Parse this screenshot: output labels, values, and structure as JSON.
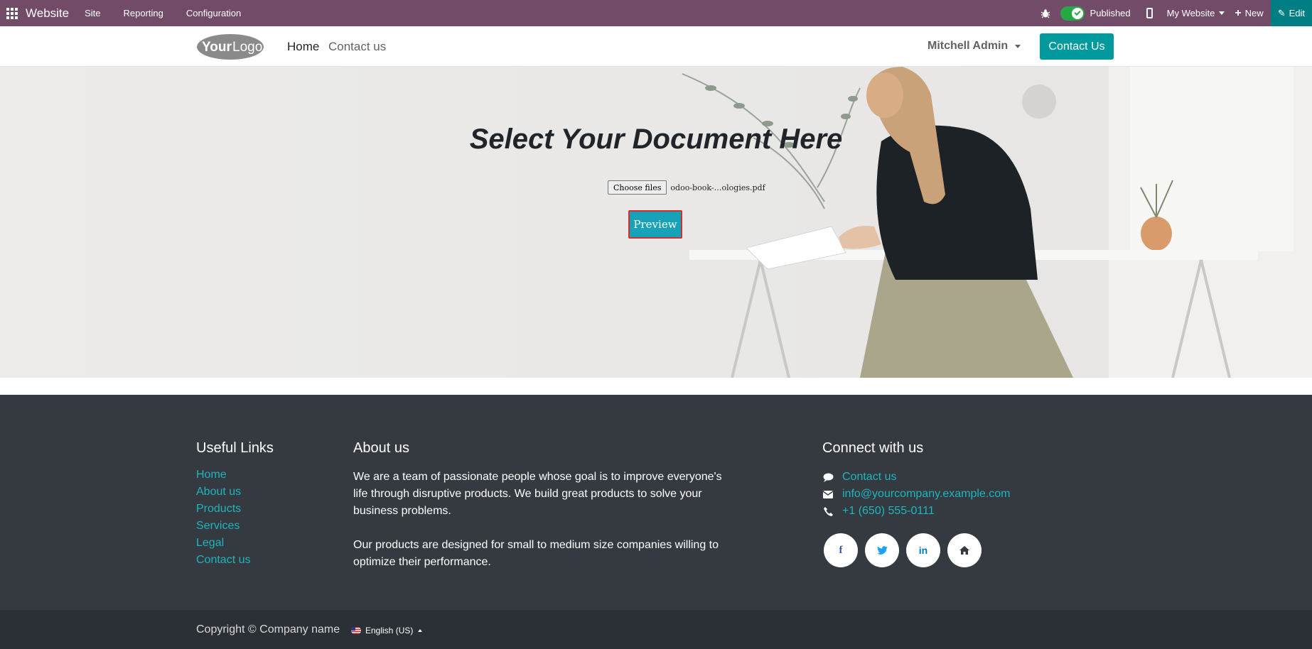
{
  "adminbar": {
    "brand": "Website",
    "menu": [
      "Site",
      "Reporting",
      "Configuration"
    ],
    "published_label": "Published",
    "website_selector": "My Website",
    "new_label": "New",
    "edit_label": "Edit",
    "colors": {
      "bar": "#714B67",
      "edit": "#017e84",
      "toggle_on": "#28a745"
    }
  },
  "header": {
    "logo_text": "YourLogo",
    "nav": [
      "Home",
      "Contact us"
    ],
    "user": "Mitchell Admin",
    "cta": "Contact Us",
    "cta_color": "#00999e"
  },
  "hero": {
    "title": "Select Your Document Here",
    "choose_files_label": "Choose files",
    "selected_file": "odoo-book-…ologies.pdf",
    "preview_label": "Preview"
  },
  "footer": {
    "useful_links": {
      "title": "Useful Links",
      "items": [
        "Home",
        "About us",
        "Products",
        "Services",
        "Legal",
        "Contact us"
      ]
    },
    "about": {
      "title": "About us",
      "paragraphs": [
        "We are a team of passionate people whose goal is to improve everyone's life through disruptive products. We build great products to solve your business problems.",
        "Our products are designed for small to medium size companies willing to optimize their performance."
      ]
    },
    "connect": {
      "title": "Connect with us",
      "items": [
        {
          "icon": "comment-icon",
          "label": "Contact us"
        },
        {
          "icon": "envelope-icon",
          "label": "info@yourcompany.example.com"
        },
        {
          "icon": "phone-icon",
          "label": "+1 (650) 555-0111"
        }
      ],
      "socials": [
        "facebook-icon",
        "twitter-icon",
        "linkedin-icon",
        "home-icon"
      ]
    },
    "copyright": "Copyright © Company name",
    "language": "English (US)",
    "link_color": "#1eb5bd"
  }
}
